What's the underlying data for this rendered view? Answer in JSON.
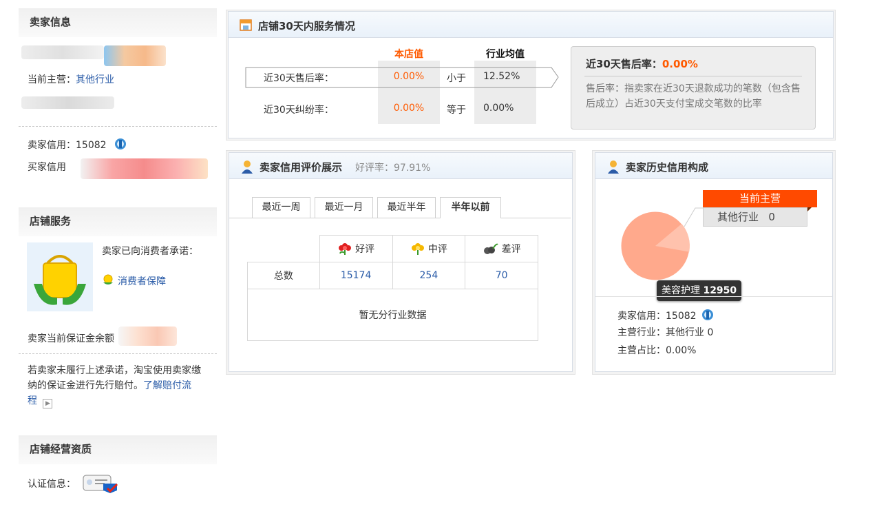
{
  "left": {
    "seller_info": {
      "title": "卖家信息",
      "main_label": "当前主营：",
      "main_value": "其他行业",
      "credit_label": "卖家信用：",
      "credit_value": "15082",
      "buyer_credit_label": "买家信用"
    },
    "shop_service": {
      "title": "店铺服务",
      "promise_text": "卖家已向消费者承诺：",
      "guarantee_link": "消费者保障",
      "deposit_label": "卖家当前保证金余额",
      "note_text": "若卖家未履行上述承诺，淘宝使用卖家缴纳的保证金进行先行赔付。",
      "note_link_part1": "了解赔付流",
      "note_link_part2": "程"
    },
    "qualification": {
      "title": "店铺经营资质",
      "cert_label": "认证信息："
    }
  },
  "service30": {
    "title": "店铺30天内服务情况",
    "col_shop": "本店值",
    "col_industry": "行业均值",
    "rows": [
      {
        "label": "近30天售后率：",
        "shop": "0.00%",
        "compare": "小于",
        "industry": "12.52%"
      },
      {
        "label": "近30天纠纷率：",
        "shop": "0.00%",
        "compare": "等于",
        "industry": "0.00%"
      }
    ],
    "tip_title": "近30天售后率：",
    "tip_value": "0.00%",
    "tip_desc": "售后率：指卖家在近30天退款成功的笔数（包含售后成立）占近30天支付宝成交笔数的比率"
  },
  "rating": {
    "title": "卖家信用评价展示",
    "good_rate_label": "好评率：",
    "good_rate_value": "97.91%",
    "tabs": [
      "最近一周",
      "最近一月",
      "最近半年",
      "半年以前"
    ],
    "active_tab": 3,
    "cols": [
      "好评",
      "中评",
      "差评"
    ],
    "row_label": "总数",
    "values": [
      "15174",
      "254",
      "70"
    ],
    "empty_text": "暂无分行业数据"
  },
  "history": {
    "title": "卖家历史信用构成",
    "legend_header": "当前主营",
    "legend_item_label": "其他行业",
    "legend_item_value": "0",
    "tooltip_label": "美容护理",
    "tooltip_value": "12950",
    "credit_line_label": "卖家信用：",
    "credit_line_value": "15082",
    "main_industry_line": "主营行业：其他行业 0",
    "main_ratio_line": "主营占比：0.00%",
    "colors": {
      "pie": "#ffa98c",
      "pie_slice": "#ffc2ad",
      "legend_header": "#ff4a00"
    }
  }
}
